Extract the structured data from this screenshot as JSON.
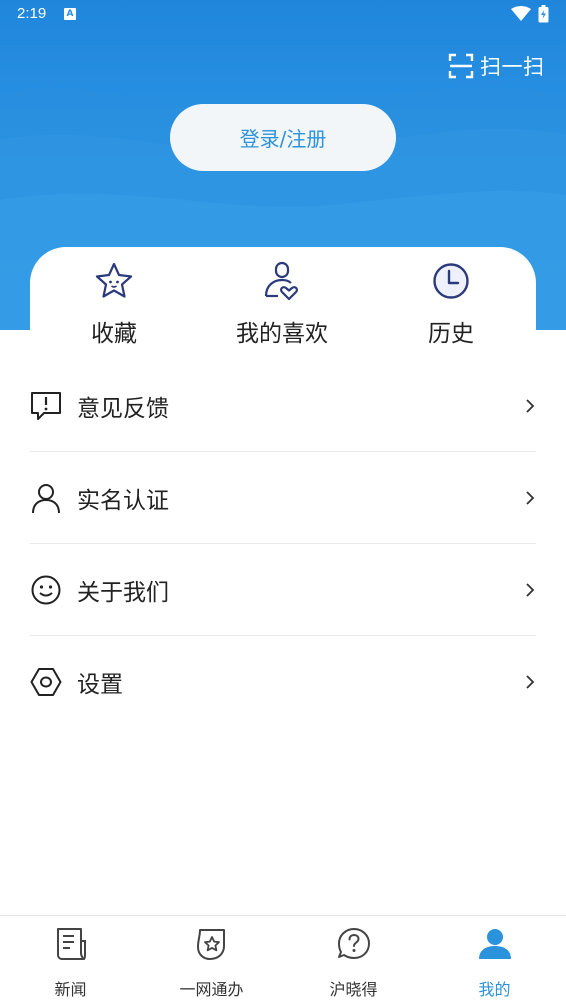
{
  "status_bar": {
    "time": "2:19",
    "notification_icon": "a-icon",
    "icons": [
      "wifi-icon",
      "battery-icon"
    ]
  },
  "header": {
    "scan_label": "扫一扫",
    "scan_icon": "scan-icon",
    "login_label": "登录/注册"
  },
  "quick_actions": [
    {
      "label": "收藏",
      "icon": "star-icon"
    },
    {
      "label": "我的喜欢",
      "icon": "person-heart-icon"
    },
    {
      "label": "历史",
      "icon": "clock-icon"
    }
  ],
  "menu": [
    {
      "label": "意见反馈",
      "icon": "feedback-icon"
    },
    {
      "label": "实名认证",
      "icon": "user-icon"
    },
    {
      "label": "关于我们",
      "icon": "smile-icon"
    },
    {
      "label": "设置",
      "icon": "hexagon-settings-icon"
    }
  ],
  "tabs": [
    {
      "label": "新闻",
      "icon": "news-icon",
      "active": false
    },
    {
      "label": "一网通办",
      "icon": "service-icon",
      "active": false
    },
    {
      "label": "沪晓得",
      "icon": "question-icon",
      "active": false
    },
    {
      "label": "我的",
      "icon": "profile-icon",
      "active": true
    }
  ],
  "colors": {
    "brand_blue": "#2b92dc",
    "header_top": "#1f86dc",
    "header_bottom": "#3aa2ea",
    "icon_navy": "#2a3a7c",
    "text_dark": "#222222"
  }
}
